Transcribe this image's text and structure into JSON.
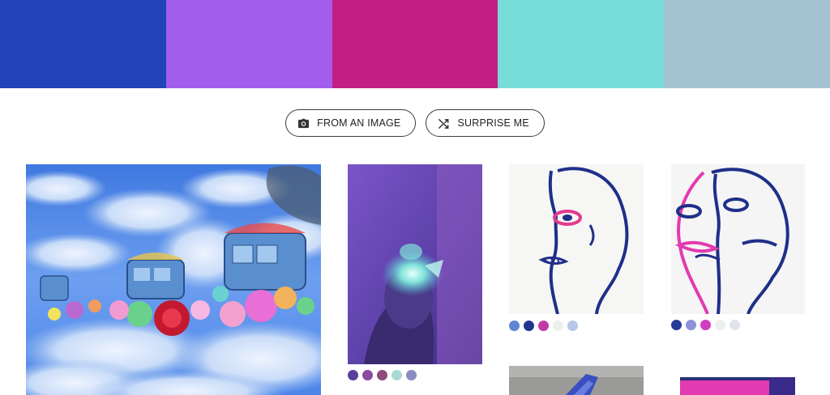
{
  "palette": {
    "colors": [
      "#2244b8",
      "#a25ded",
      "#c21f82",
      "#78dcd8",
      "#a3c3d0"
    ]
  },
  "actions": {
    "from_image": {
      "label": "FROM AN IMAGE",
      "icon": "camera-icon"
    },
    "surprise": {
      "label": "SURPRISE ME",
      "icon": "shuffle-icon"
    }
  },
  "gallery": {
    "cards": [
      {
        "subject": "flower-covered trains in clouds",
        "palette": []
      },
      {
        "subject": "figure with glowing light",
        "palette": [
          "#5a3f9e",
          "#8a4aa0",
          "#8e4a7e",
          "#a9d9d3",
          "#8b8cc2"
        ]
      },
      {
        "subject": "blue line face drawing",
        "palette": [
          "#5e86d2",
          "#21368f",
          "#c23aa6",
          "#ecf0ec",
          "#b5c8e6"
        ]
      },
      {
        "subject": "blue and pink face drawing",
        "palette": [
          "#273a98",
          "#8c92d6",
          "#d23cc2",
          "#eef0ee",
          "#dfe3ee"
        ]
      },
      {
        "subject": "grey photo",
        "palette": []
      },
      {
        "subject": "pink artwork",
        "palette": []
      }
    ]
  }
}
